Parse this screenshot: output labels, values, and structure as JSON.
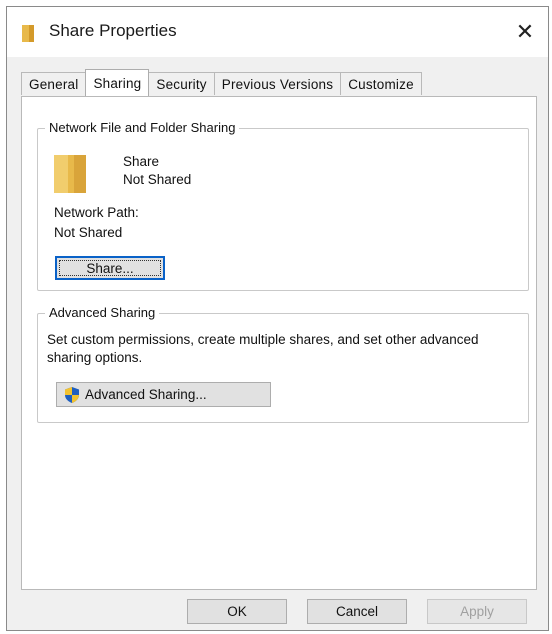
{
  "window": {
    "title": "Share Properties",
    "close_label": "✕"
  },
  "tabs": [
    {
      "label": "General"
    },
    {
      "label": "Sharing",
      "active": true
    },
    {
      "label": "Security"
    },
    {
      "label": "Previous Versions"
    },
    {
      "label": "Customize"
    }
  ],
  "network_sharing": {
    "group_title": "Network File and Folder Sharing",
    "share_name": "Share",
    "share_status": "Not Shared",
    "network_path_label": "Network Path:",
    "network_path_value": "Not Shared",
    "share_button_label": "Share..."
  },
  "advanced_sharing": {
    "group_title": "Advanced Sharing",
    "description": "Set custom permissions, create multiple shares, and set other advanced sharing options.",
    "button_label": "Advanced Sharing..."
  },
  "buttons": {
    "ok": "OK",
    "cancel": "Cancel",
    "apply": "Apply"
  },
  "icons": {
    "folder": "folder-icon",
    "shield": "uac-shield-icon"
  },
  "colors": {
    "folder": "#e8b94a",
    "focus_border": "#0a62c8"
  }
}
